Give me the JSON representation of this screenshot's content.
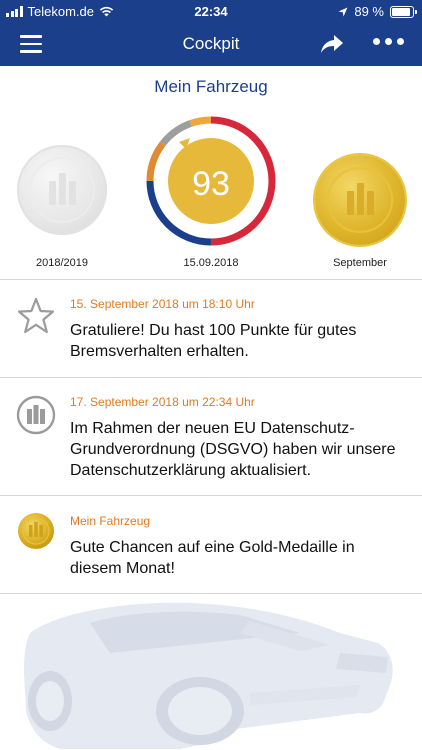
{
  "status_bar": {
    "carrier": "Telekom.de",
    "time": "22:34",
    "battery": "89 %",
    "battery_level": 0.89
  },
  "navbar": {
    "title": "Cockpit",
    "menu_icon": "hamburger-menu-icon",
    "share_icon": "share-arrow-icon",
    "more_icon": "more-dots-icon"
  },
  "vehicle": {
    "title": "Mein Fahrzeug",
    "left_medal_label": "2018/2019",
    "score": "93",
    "score_date": "15.09.2018",
    "right_medal_label": "September"
  },
  "colors": {
    "brand": "#1b3f8a",
    "accent": "#e07b1f",
    "gold": "#e6b93a",
    "ring_red": "#d7273a",
    "ring_blue": "#1b3f8a",
    "ring_orange": "#f0a63a",
    "ring_grey": "#9e9e9e"
  },
  "feed": [
    {
      "icon": "star-outline-icon",
      "date": "15. September 2018 um 18:10 Uhr",
      "text": "Gratuliere! Du hast 100 Punkte für gutes Bremsverhalten erhalten."
    },
    {
      "icon": "allianz-logo-icon",
      "date": "17. September 2018 um 22:34 Uhr",
      "text": "Im Rahmen der neuen EU Datenschutz-Grundverordnung (DSGVO) haben wir unsere Datenschutzerklärung aktualisiert."
    },
    {
      "icon": "gold-medal-icon",
      "date": "Mein Fahrzeug",
      "text": "Gute Chancen auf eine Gold-Medaille in diesem Monat!"
    }
  ]
}
